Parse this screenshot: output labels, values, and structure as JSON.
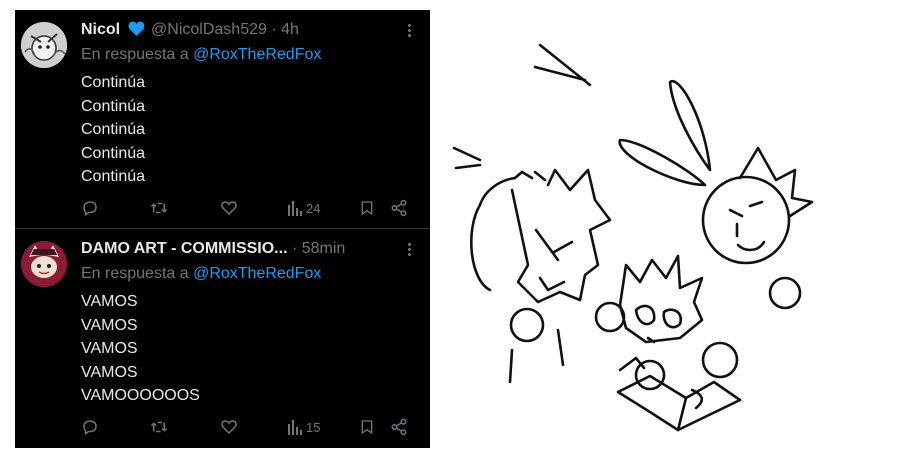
{
  "tweets": [
    {
      "name": "Nicol",
      "handle_time": "@NicolDash529 · 4h",
      "reply_prefix": "En respuesta a",
      "reply_mention": "@RoxTheRedFox",
      "lines": [
        "Continúa",
        "Continúa",
        "Continúa",
        "Continúa",
        "Continúa"
      ],
      "views": "24",
      "verified_color": "#1d9bf0",
      "icons": [
        "reply-icon",
        "retweet-icon",
        "like-icon",
        "views-icon",
        "bookmark-icon",
        "share-icon"
      ]
    },
    {
      "name": "DAMO ART - COMMISSIO...",
      "handle_time": "· 58min",
      "reply_prefix": "En respuesta a",
      "reply_mention": "@RoxTheRedFox",
      "lines": [
        "VAMOS",
        "VAMOS",
        "VAMOS",
        "VAMOS",
        "VAMOOOOOOS"
      ],
      "views": "15",
      "icons": [
        "reply-icon",
        "retweet-icon",
        "like-icon",
        "views-icon",
        "bookmark-icon",
        "share-icon"
      ]
    }
  ],
  "colors": {
    "background": "#000000",
    "text": "#e7e9ea",
    "muted": "#71767b",
    "mention": "#1d9bf0"
  }
}
